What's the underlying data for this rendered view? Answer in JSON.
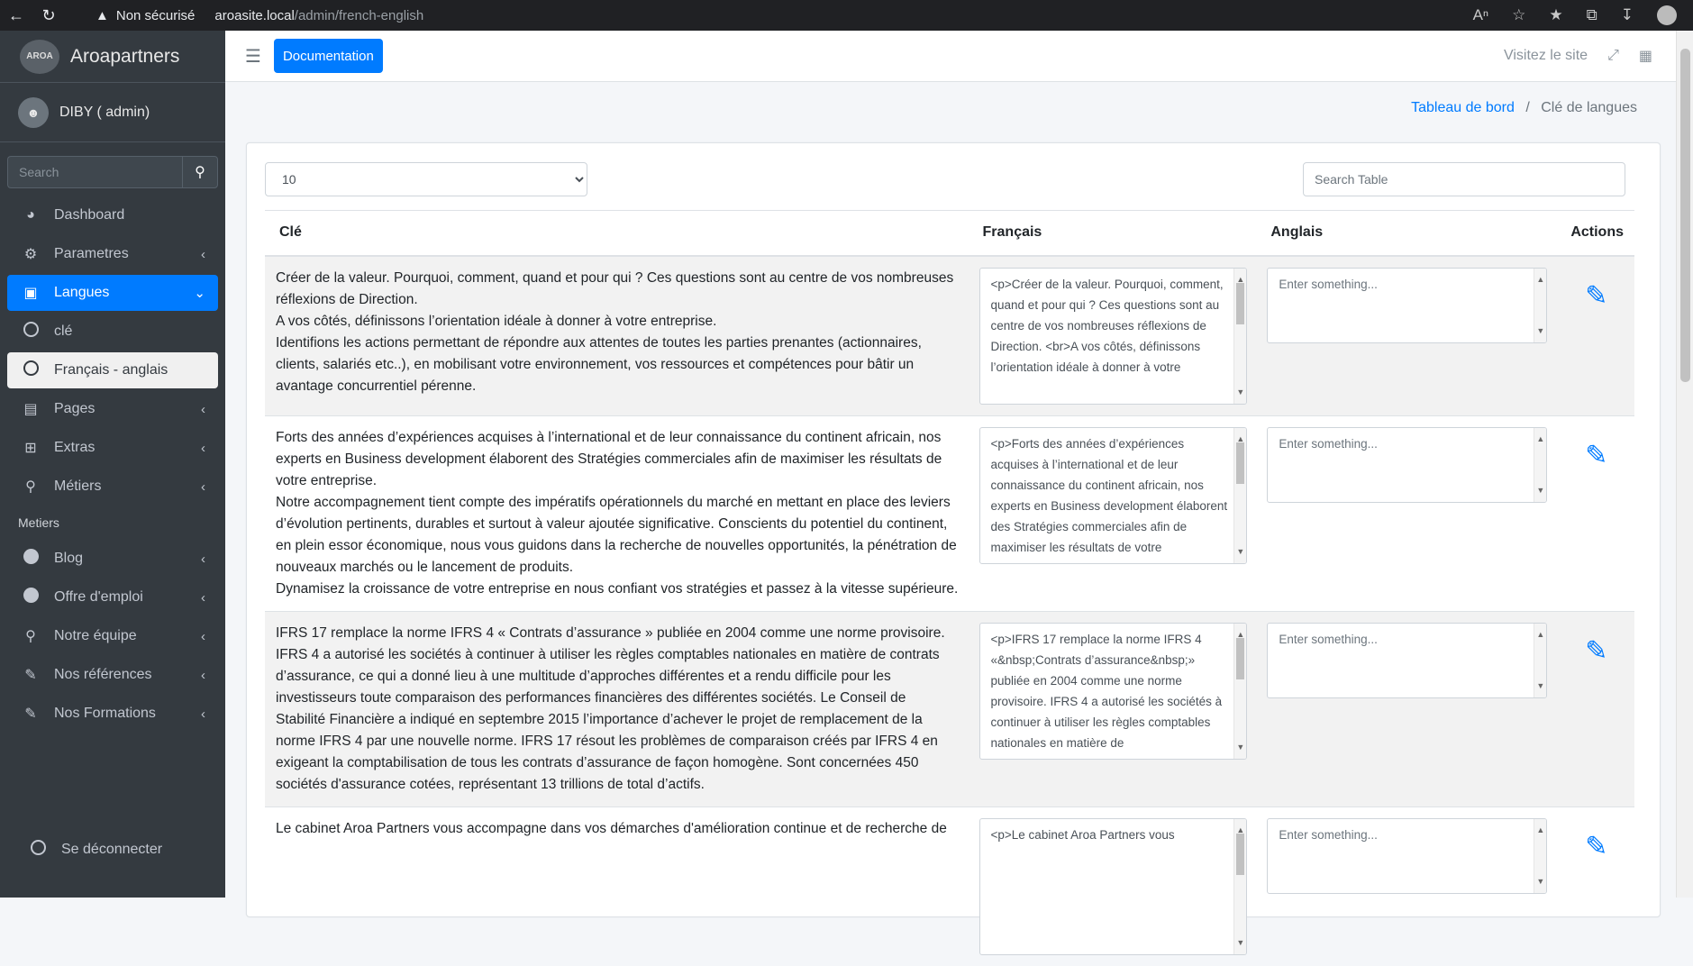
{
  "browser": {
    "security": "Non sécurisé",
    "host": "aroasite.local",
    "path": "/admin/french-english"
  },
  "sidebar": {
    "brand": "Aroapartners",
    "logo_text": "AROA",
    "user": "DIBY ( admin)",
    "search_placeholder": "Search",
    "items": [
      {
        "label": "Dashboard"
      },
      {
        "label": "Parametres"
      },
      {
        "label": "Langues"
      },
      {
        "label": "clé"
      },
      {
        "label": "Français - anglais"
      },
      {
        "label": "Pages"
      },
      {
        "label": "Extras"
      },
      {
        "label": "Métiers"
      }
    ],
    "section_header": "Metiers",
    "items2": [
      {
        "label": "Blog"
      },
      {
        "label": "Offre d'emploi"
      },
      {
        "label": "Notre équipe"
      },
      {
        "label": "Nos références"
      },
      {
        "label": "Nos Formations"
      }
    ],
    "logout": "Se déconnecter"
  },
  "topbar": {
    "doc_button": "Documentation",
    "visit": "Visitez le site"
  },
  "breadcrumb": {
    "home": "Tableau de bord",
    "sep": "/",
    "current": "Clé de langues"
  },
  "table": {
    "page_size": "10",
    "search_placeholder": "Search Table",
    "columns": [
      "Clé",
      "Français",
      "Anglais",
      "Actions"
    ],
    "en_placeholder": "Enter something...",
    "rows": [
      {
        "key": "Créer de la valeur. Pourquoi, comment, quand et pour qui ? Ces questions sont au centre de vos nombreuses réflexions de Direction.\nA vos côtés, définissons l’orientation idéale à donner à votre entreprise.\nIdentifions les actions permettant de répondre aux attentes de toutes les parties prenantes (actionnaires, clients, salariés etc..), en mobilisant votre environnement, vos ressources et compétences pour bâtir un avantage concurrentiel pérenne.",
        "fr": "<p>Créer de la valeur. Pourquoi, comment, quand et pour qui ? Ces questions sont au centre de vos nombreuses réflexions de Direction. <br>A vos côtés, définissons l’orientation idéale à donner à votre"
      },
      {
        "key": "Forts des années d’expériences acquises à l’international et de leur connaissance du continent africain, nos experts en Business development élaborent des Stratégies commerciales afin de maximiser les résultats de votre entreprise.\nNotre accompagnement tient compte des impératifs opérationnels du marché en mettant en place des leviers d’évolution pertinents, durables et surtout à valeur ajoutée significative. Conscients du potentiel du continent, en plein essor économique, nous vous guidons dans la recherche de nouvelles opportunités, la pénétration de nouveaux marchés ou le lancement de produits.\nDynamisez la croissance de votre entreprise en nous confiant vos stratégies et passez à la vitesse supérieure.",
        "fr": "<p>Forts des années d’expériences acquises à l’international et de leur connaissance du continent africain, nos experts en Business development élaborent des Stratégies commerciales afin de maximiser les résultats de votre"
      },
      {
        "key": "IFRS 17 remplace la norme IFRS 4 « Contrats d’assurance » publiée en 2004 comme une norme provisoire. IFRS 4 a autorisé les sociétés à continuer à utiliser les règles comptables nationales en matière de contrats d’assurance, ce qui a donné lieu à une multitude d’approches différentes et a rendu difficile pour les investisseurs toute comparaison des performances financières des différentes sociétés. Le Conseil de Stabilité Financière a indiqué en septembre 2015 l’importance d’achever le projet de remplacement de la norme IFRS 4 par une nouvelle norme. IFRS 17 résout les problèmes de comparaison créés par IFRS 4 en exigeant la comptabilisation de tous les contrats d’assurance de façon homogène. Sont concernées 450 sociétés d'assurance cotées, représentant 13 trillions de total d’actifs.",
        "fr": "<p>IFRS 17 remplace la norme IFRS 4 «&nbsp;Contrats d’assurance&nbsp;» publiée en 2004 comme une norme provisoire. IFRS 4 a autorisé les sociétés à continuer à utiliser les règles comptables nationales en matière de"
      },
      {
        "key": "Le cabinet Aroa Partners vous accompagne dans vos démarches d'amélioration continue et de recherche de",
        "fr": "<p>Le cabinet Aroa Partners vous"
      }
    ]
  }
}
